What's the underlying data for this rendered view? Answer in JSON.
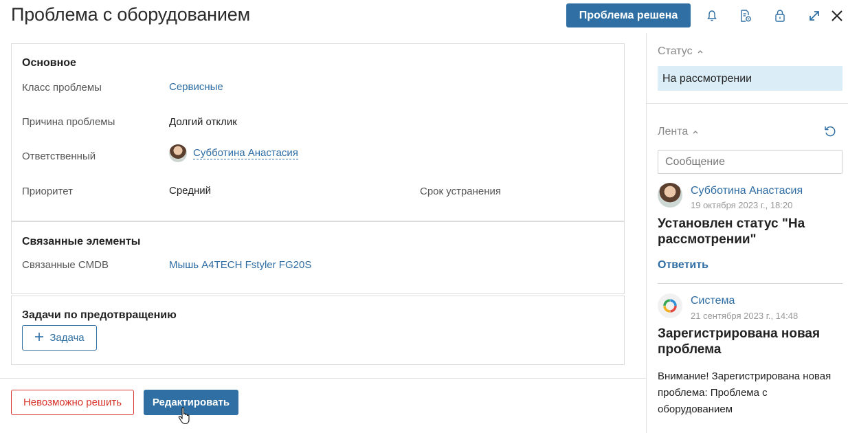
{
  "header": {
    "title": "Проблема с оборудованием",
    "resolve_button": "Проблема решена"
  },
  "main": {
    "basic": {
      "heading": "Основное",
      "class_label": "Класс проблемы",
      "class_value": "Сервисные",
      "cause_label": "Причина проблемы",
      "cause_value": "Долгий отклик",
      "responsible_label": "Ответственный",
      "responsible_value": "Субботина Анастасия",
      "priority_label": "Приоритет",
      "priority_value": "Средний",
      "deadline_label": "Срок устранения"
    },
    "related": {
      "heading": "Связанные элементы",
      "cmdb_label": "Связанные CMDB",
      "cmdb_value": "Мышь A4TECH Fstyler FG20S"
    },
    "tasks": {
      "heading": "Задачи по предотвращению",
      "add_button": "Задача"
    }
  },
  "footer": {
    "cannot_resolve": "Невозможно решить",
    "edit": "Редактировать"
  },
  "sidebar": {
    "status_heading": "Статус",
    "status_value": "На рассмотрении",
    "feed_heading": "Лента",
    "message_placeholder": "Сообщение",
    "feed": [
      {
        "author": "Субботина Анастасия",
        "time": "19 октября 2023 г., 18:20",
        "title": "Установлен статус \"На рассмотрении\"",
        "reply": "Ответить"
      },
      {
        "author": "Система",
        "time": "21 сентября 2023 г., 14:48",
        "title": "Зарегистрирована новая проблема",
        "body": "Внимание! Зарегистрирована новая проблема: Проблема с оборудованием"
      }
    ]
  },
  "colors": {
    "accent": "#2f6fa3",
    "danger": "#d9342b",
    "status_bg": "#dbeef7"
  }
}
